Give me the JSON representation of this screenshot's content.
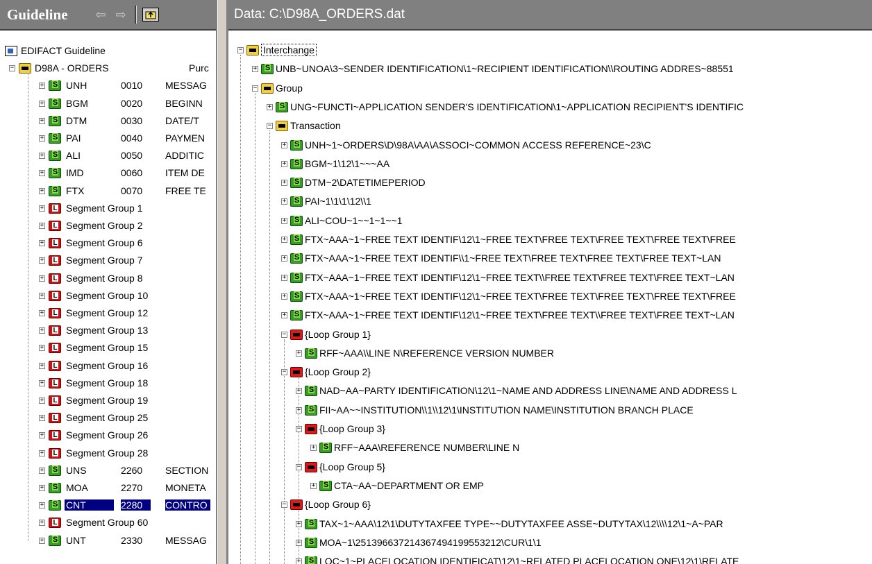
{
  "guideline": {
    "title": "Guideline",
    "root_label": "EDIFACT Guideline",
    "message": {
      "code": "D98A - ORDERS",
      "desc": "Purc"
    },
    "items": [
      {
        "kind": "seg",
        "tag": "UNH",
        "num": "0010",
        "desc": "MESSAG"
      },
      {
        "kind": "seg",
        "tag": "BGM",
        "num": "0020",
        "desc": "BEGINN"
      },
      {
        "kind": "seg",
        "tag": "DTM",
        "num": "0030",
        "desc": "DATE/T"
      },
      {
        "kind": "seg",
        "tag": "PAI",
        "num": "0040",
        "desc": "PAYMEN"
      },
      {
        "kind": "seg",
        "tag": "ALI",
        "num": "0050",
        "desc": "ADDITIC"
      },
      {
        "kind": "seg",
        "tag": "IMD",
        "num": "0060",
        "desc": "ITEM DE"
      },
      {
        "kind": "seg",
        "tag": "FTX",
        "num": "0070",
        "desc": "FREE TE"
      },
      {
        "kind": "grp",
        "label": "Segment Group 1"
      },
      {
        "kind": "grp",
        "label": "Segment Group 2"
      },
      {
        "kind": "grp",
        "label": "Segment Group 6"
      },
      {
        "kind": "grp",
        "label": "Segment Group 7"
      },
      {
        "kind": "grp",
        "label": "Segment Group 8"
      },
      {
        "kind": "grp",
        "label": "Segment Group 10"
      },
      {
        "kind": "grp",
        "label": "Segment Group 12"
      },
      {
        "kind": "grp",
        "label": "Segment Group 13"
      },
      {
        "kind": "grp",
        "label": "Segment Group 15"
      },
      {
        "kind": "grp",
        "label": "Segment Group 16"
      },
      {
        "kind": "grp",
        "label": "Segment Group 18"
      },
      {
        "kind": "grp",
        "label": "Segment Group 19"
      },
      {
        "kind": "grp",
        "label": "Segment Group 25"
      },
      {
        "kind": "grp",
        "label": "Segment Group 26"
      },
      {
        "kind": "grp",
        "label": "Segment Group 28"
      },
      {
        "kind": "seg",
        "tag": "UNS",
        "num": "2260",
        "desc": "SECTION"
      },
      {
        "kind": "seg",
        "tag": "MOA",
        "num": "2270",
        "desc": "MONETA"
      },
      {
        "kind": "seg",
        "tag": "CNT",
        "num": "2280",
        "desc": "CONTRO",
        "selected": true
      },
      {
        "kind": "grp",
        "label": "Segment Group 60"
      },
      {
        "kind": "seg",
        "tag": "UNT",
        "num": "2330",
        "desc": "MESSAG"
      }
    ]
  },
  "data_pane": {
    "title": "Data: C:\\D98A_ORDERS.dat",
    "rows": [
      {
        "depth": 0,
        "icon": "folder",
        "exp": "−",
        "text": "Interchange",
        "boxed": true
      },
      {
        "depth": 1,
        "icon": "seg",
        "exp": "+",
        "text": "UNB~UNOA\\3~SENDER IDENTIFICATION\\1~RECIPIENT IDENTIFICATION\\\\ROUTING ADDRES~88551"
      },
      {
        "depth": 1,
        "icon": "folder",
        "exp": "−",
        "text": "Group"
      },
      {
        "depth": 2,
        "icon": "seg",
        "exp": "+",
        "text": "UNG~FUNCTI~APPLICATION SENDER'S IDENTIFICATION\\1~APPLICATION RECIPIENT'S IDENTIFIC"
      },
      {
        "depth": 2,
        "icon": "folder",
        "exp": "−",
        "text": "Transaction"
      },
      {
        "depth": 3,
        "icon": "seg",
        "exp": "+",
        "text": "UNH~1~ORDERS\\D\\98A\\AA\\ASSOCI~COMMON ACCESS REFERENCE~23\\C"
      },
      {
        "depth": 3,
        "icon": "seg",
        "exp": "+",
        "text": "BGM~1\\12\\1~~~AA"
      },
      {
        "depth": 3,
        "icon": "seg",
        "exp": "+",
        "text": "DTM~2\\DATETIMEPERIOD"
      },
      {
        "depth": 3,
        "icon": "seg",
        "exp": "+",
        "text": "PAI~1\\1\\1\\12\\\\1"
      },
      {
        "depth": 3,
        "icon": "seg",
        "exp": "+",
        "text": "ALI~COU~1~~1~1~~1"
      },
      {
        "depth": 3,
        "icon": "seg",
        "exp": "+",
        "text": "FTX~AAA~1~FREE TEXT IDENTIF\\12\\1~FREE TEXT\\FREE TEXT\\FREE TEXT\\FREE TEXT\\FREE"
      },
      {
        "depth": 3,
        "icon": "seg",
        "exp": "+",
        "text": "FTX~AAA~1~FREE TEXT IDENTIF\\\\1~FREE TEXT\\FREE TEXT\\FREE TEXT\\FREE TEXT~LAN"
      },
      {
        "depth": 3,
        "icon": "seg",
        "exp": "+",
        "text": "FTX~AAA~1~FREE TEXT IDENTIF\\12\\1~FREE TEXT\\\\FREE TEXT\\FREE TEXT\\FREE TEXT~LAN"
      },
      {
        "depth": 3,
        "icon": "seg",
        "exp": "+",
        "text": "FTX~AAA~1~FREE TEXT IDENTIF\\12\\1~FREE TEXT\\FREE TEXT\\FREE TEXT\\FREE TEXT\\FREE"
      },
      {
        "depth": 3,
        "icon": "seg",
        "exp": "+",
        "text": "FTX~AAA~1~FREE TEXT IDENTIF\\12\\1~FREE TEXT\\FREE TEXT\\\\FREE TEXT\\FREE TEXT~LAN"
      },
      {
        "depth": 3,
        "icon": "rloop",
        "exp": "−",
        "text": "{Loop Group 1}"
      },
      {
        "depth": 4,
        "icon": "seg",
        "exp": "+",
        "text": "RFF~AAA\\\\LINE N\\REFERENCE VERSION NUMBER"
      },
      {
        "depth": 3,
        "icon": "rloop",
        "exp": "−",
        "text": "{Loop Group 2}"
      },
      {
        "depth": 4,
        "icon": "seg",
        "exp": "+",
        "text": "NAD~AA~PARTY IDENTIFICATION\\12\\1~NAME AND ADDRESS LINE\\NAME AND ADDRESS L"
      },
      {
        "depth": 4,
        "icon": "seg",
        "exp": "+",
        "text": "FII~AA~~INSTITUTION\\\\1\\\\12\\1\\INSTITUTION NAME\\INSTITUTION BRANCH PLACE"
      },
      {
        "depth": 4,
        "icon": "rloop",
        "exp": "−",
        "text": "{Loop Group 3}"
      },
      {
        "depth": 5,
        "icon": "seg",
        "exp": "+",
        "text": "RFF~AAA\\REFERENCE NUMBER\\LINE N"
      },
      {
        "depth": 4,
        "icon": "rloop",
        "exp": "−",
        "text": "{Loop Group 5}"
      },
      {
        "depth": 5,
        "icon": "seg",
        "exp": "+",
        "text": "CTA~AA~DEPARTMENT OR EMP"
      },
      {
        "depth": 3,
        "icon": "rloop",
        "exp": "−",
        "text": "{Loop Group 6}"
      },
      {
        "depth": 4,
        "icon": "seg",
        "exp": "+",
        "text": "TAX~1~AAA\\12\\1\\DUTYTAXFEE TYPE~~DUTYTAXFEE ASSE~DUTYTAX\\12\\\\\\\\12\\1~A~PAR"
      },
      {
        "depth": 4,
        "icon": "seg",
        "exp": "+",
        "text": "MOA~1\\251396637214367494199553212\\CUR\\1\\1"
      },
      {
        "depth": 4,
        "icon": "seg",
        "exp": "+",
        "text": "LOC~1~PLACELOCATION IDENTIFICAT\\12\\1~RELATED PLACELOCATION ONE\\12\\1\\RELATE"
      }
    ]
  }
}
